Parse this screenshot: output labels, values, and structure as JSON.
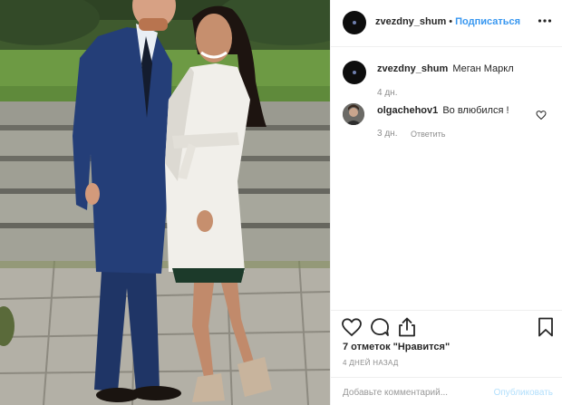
{
  "post": {
    "author": "zvezdny_shum",
    "separator": "•",
    "follow_label": "Подписаться",
    "caption": "Меган Маркл",
    "caption_time": "4 дн."
  },
  "comments": [
    {
      "username": "olgachehov1",
      "text": "Во влюбился !",
      "time": "3 дн.",
      "reply_label": "Ответить"
    }
  ],
  "actions": {
    "likes_text": "7 отметок \"Нравится\"",
    "posted_ago": "4 ДНЕЙ НАЗАД"
  },
  "comment_box": {
    "placeholder": "Добавьте комментарий...",
    "publish_label": "Опубликовать"
  },
  "icons": {
    "more": "more-options-icon",
    "heart": "heart-icon",
    "comment": "comment-icon",
    "share": "share-icon",
    "bookmark": "bookmark-icon",
    "like_comment": "heart-icon"
  },
  "colors": {
    "link_blue": "#3897f0",
    "publish_disabled": "#b2dffc",
    "muted_text": "#8e8e8e",
    "border": "#efefef"
  }
}
